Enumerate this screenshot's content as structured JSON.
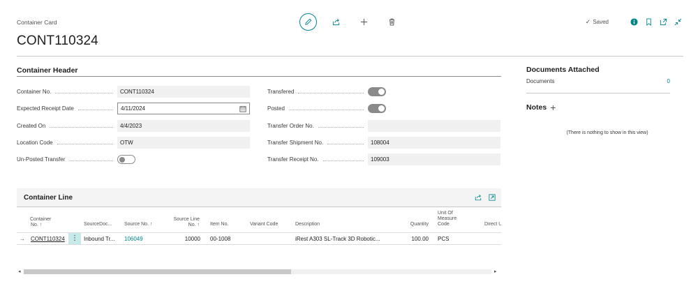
{
  "page": {
    "caption": "Container Card",
    "title": "CONT110324"
  },
  "toolbar": {
    "edit_icon": "pencil-icon",
    "share_icon": "share-icon",
    "new_icon": "plus-icon",
    "delete_icon": "trash-icon"
  },
  "status": {
    "saved_label": "Saved",
    "icons": [
      "info-icon",
      "bookmark-icon",
      "open-new-window-icon",
      "collapse-icon"
    ]
  },
  "header": {
    "title": "Container Header",
    "left_fields": [
      {
        "label": "Container No.",
        "value": "CONT110324"
      },
      {
        "label": "Expected Receipt Date",
        "value": "4/11/2024"
      },
      {
        "label": "Created On",
        "value": "4/4/2023"
      },
      {
        "label": "Location Code",
        "value": "OTW"
      },
      {
        "label": "Un-Posted Transfer",
        "toggle": false
      }
    ],
    "right_fields": [
      {
        "label": "Transfered",
        "toggle": true
      },
      {
        "label": "Posted",
        "toggle": true
      },
      {
        "label": "Transfer Order No.",
        "value": ""
      },
      {
        "label": "Transfer Shipment No.",
        "value": "108004"
      },
      {
        "label": "Transfer Receipt No.",
        "value": "109003"
      }
    ]
  },
  "lines": {
    "title": "Container Line",
    "columns": {
      "container_no_1": "Container",
      "container_no_2": "No. ↑",
      "source_doc": "SourceDoc...",
      "source_no": "Source No. ↑",
      "source_line_1": "Source Line",
      "source_line_2": "No. ↑",
      "item_no": "Item No.",
      "variant_code": "Variant Code",
      "description": "Description",
      "quantity": "Quantity",
      "uom_1": "Unit Of",
      "uom_2": "Measure",
      "uom_3": "Code",
      "direct": "Direct U"
    },
    "row": {
      "arrow": "→",
      "container_no": "CONT110324",
      "source_doc": "Inbound Tr...",
      "source_no": "106049",
      "source_line": "10000",
      "item_no": "00-1008",
      "variant_code": "",
      "description": "iRest A303 SL-Track 3D Robotic...",
      "quantity": "100.00",
      "uom": "PCS",
      "direct": ""
    },
    "scroll": {
      "left_arrow": "◂",
      "right_arrow": "▸"
    }
  },
  "factbox": {
    "docs_title": "Documents Attached",
    "docs_label": "Documents",
    "docs_count": "0",
    "notes_title": "Notes",
    "notes_add": "+",
    "notes_empty": "(There is nothing to show in this view)"
  }
}
